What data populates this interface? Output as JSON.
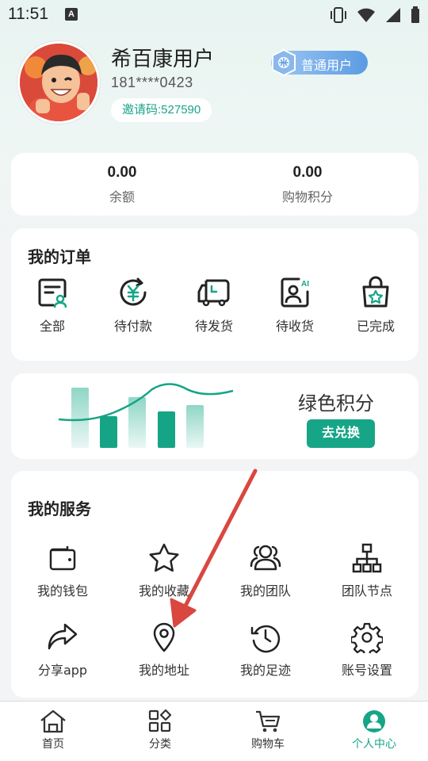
{
  "status_bar": {
    "time": "11:51",
    "notif_letter": "A"
  },
  "profile": {
    "name": "希百康用户",
    "phone": "181****0423",
    "invite_code": "邀请码:527590",
    "member_level": "普通用户"
  },
  "balances": [
    {
      "value": "0.00",
      "label": "余额"
    },
    {
      "value": "0.00",
      "label": "购物积分"
    }
  ],
  "orders": {
    "title": "我的订单",
    "items": [
      {
        "label": "全部",
        "icon": "all-orders-icon"
      },
      {
        "label": "待付款",
        "icon": "pending-payment-icon"
      },
      {
        "label": "待发货",
        "icon": "pending-shipment-icon"
      },
      {
        "label": "待收货",
        "icon": "pending-receipt-icon"
      },
      {
        "label": "已完成",
        "icon": "completed-icon"
      }
    ]
  },
  "green_points": {
    "title": "绿色积分",
    "button": "去兑换"
  },
  "services": {
    "title": "我的服务",
    "items": [
      {
        "label": "我的钱包",
        "icon": "wallet-icon"
      },
      {
        "label": "我的收藏",
        "icon": "star-icon"
      },
      {
        "label": "我的团队",
        "icon": "team-icon"
      },
      {
        "label": "团队节点",
        "icon": "node-tree-icon"
      },
      {
        "label": "分享app",
        "icon": "share-icon"
      },
      {
        "label": "我的地址",
        "icon": "location-pin-icon"
      },
      {
        "label": "我的足迹",
        "icon": "history-icon"
      },
      {
        "label": "账号设置",
        "icon": "gear-icon"
      }
    ]
  },
  "tabbar": [
    {
      "label": "首页",
      "icon": "home-icon",
      "active": false
    },
    {
      "label": "分类",
      "icon": "category-icon",
      "active": false
    },
    {
      "label": "购物车",
      "icon": "cart-icon",
      "active": false
    },
    {
      "label": "个人中心",
      "icon": "profile-icon",
      "active": true
    }
  ],
  "colors": {
    "accent": "#17a587",
    "arrow": "#d9473f",
    "member_badge": "#5b9be3"
  }
}
